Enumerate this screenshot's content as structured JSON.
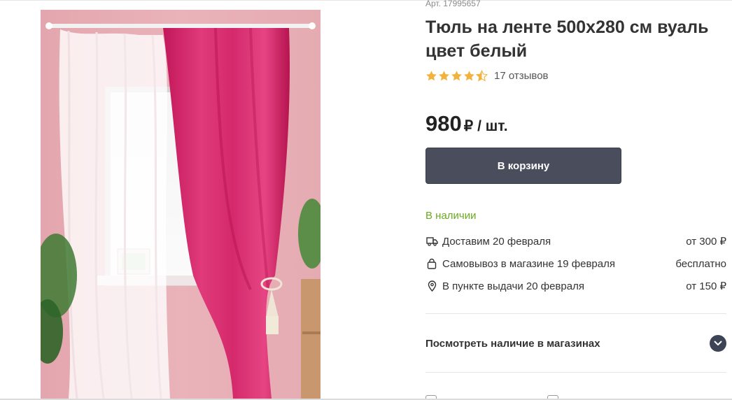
{
  "product": {
    "sku": "Арт. 17995657",
    "title": "Тюль на ленте 500х280 см вуаль цвет белый",
    "rating": 4.5,
    "reviews": "17 отзывов",
    "price_value": "980",
    "price_currency": "₽",
    "price_unit": "/ шт."
  },
  "actions": {
    "cart_label": "В корзину"
  },
  "availability": {
    "status": "В наличии",
    "status_color": "#6aaa1e"
  },
  "delivery": [
    {
      "icon": "truck-icon",
      "text": "Доставим 20 февраля",
      "price": "от 300 ₽"
    },
    {
      "icon": "bag-icon",
      "text": "Самовывоз в магазине 19 февраля",
      "price": "бесплатно"
    },
    {
      "icon": "location-pin-icon",
      "text": "В пункте выдачи 20 февраля",
      "price": "от 150 ₽"
    }
  ],
  "stores": {
    "label": "Посмотреть наличие в магазинах"
  },
  "colors": {
    "accent_button": "#4a4e5c",
    "star": "#f2b33d"
  }
}
